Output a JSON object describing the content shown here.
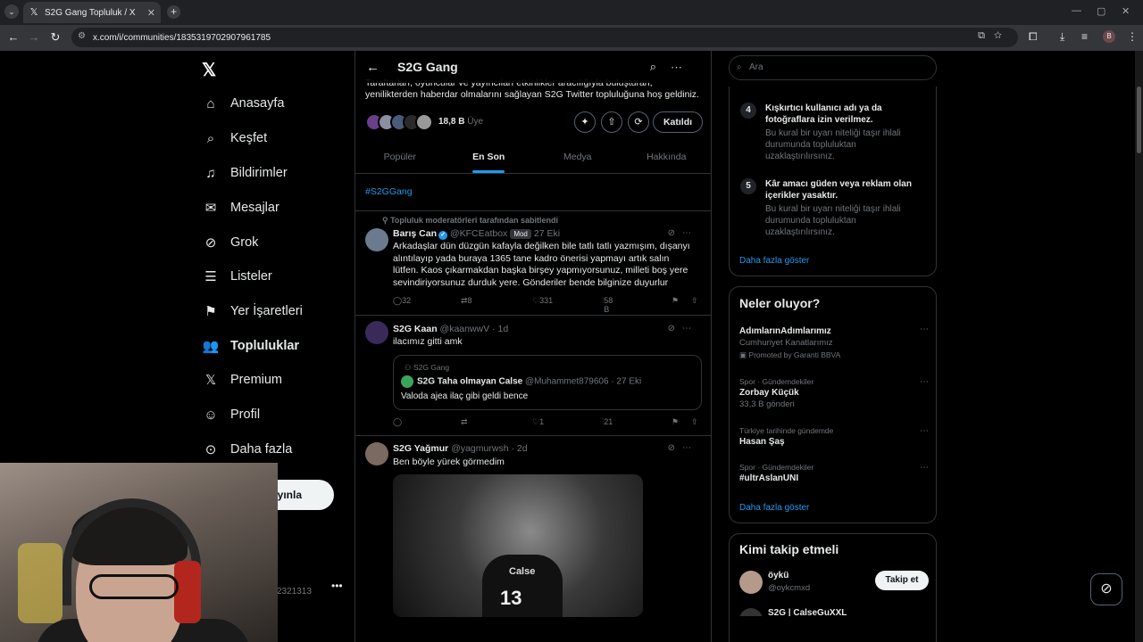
{
  "browser": {
    "tab_title": "S2G Gang Topluluk / X",
    "url": "x.com/i/communities/1835319702907961785",
    "profile_initial": "B"
  },
  "nav": {
    "items": [
      {
        "label": "Anasayfa",
        "icon": "home-icon"
      },
      {
        "label": "Keşfet",
        "icon": "search-icon"
      },
      {
        "label": "Bildirimler",
        "icon": "bell-icon"
      },
      {
        "label": "Mesajlar",
        "icon": "mail-icon"
      },
      {
        "label": "Grok",
        "icon": "grok-icon"
      },
      {
        "label": "Listeler",
        "icon": "list-icon"
      },
      {
        "label": "Yer İşaretleri",
        "icon": "bookmark-icon"
      },
      {
        "label": "Topluluklar",
        "icon": "communities-icon"
      },
      {
        "label": "Premium",
        "icon": "x-logo-icon"
      },
      {
        "label": "Profil",
        "icon": "profile-icon"
      },
      {
        "label": "Daha fazla",
        "icon": "more-icon"
      }
    ],
    "post_button": "ayınla",
    "account_handle": "2321313"
  },
  "community": {
    "name": "S2G Gang",
    "description_line1": "Taraftarları, oyuncular ve yayıncıları etkinlikler aracılığıyla buluşturan,",
    "description_line2": "yenilikterden haberdar olmalarını sağlayan S2G Twitter topluluğuna hoş geldiniz.",
    "member_count": "18,8 B",
    "member_label": "Üye",
    "join_label": "Katıldı",
    "tabs": [
      {
        "label": "Popüler",
        "active": false
      },
      {
        "label": "En Son",
        "active": true
      },
      {
        "label": "Medya",
        "active": false
      },
      {
        "label": "Hakkında",
        "active": false
      }
    ],
    "hashtag": "#S2GGang"
  },
  "posts": [
    {
      "pinned_label": "Topluluk moderatörleri tarafından sabitlendi",
      "name": "Barış Can",
      "handle": "@KFCEatbox",
      "badge": "Mod",
      "time": "27 Eki",
      "text": "Arkadaşlar dün düzgün kafayla değilken bile tatlı tatlı yazmışım, dışanyı alıntılayıp yada buraya 1365 tane kadro önerisi yapmayı artık salın lütfen. Kaos çıkarmakdan başka birşey yapmıyorsunuz, milleti boş yere sevindiriyorsunuz durduk yere. Gönderiler bende bilginize duyurlur",
      "replies": "32",
      "reposts": "8",
      "likes": "331",
      "views": "58 B"
    },
    {
      "name": "S2G Kaan",
      "handle": "@kaanwwV",
      "time": "1d",
      "text": "ilacımız gitti amk",
      "quote": {
        "community": "S2G Gang",
        "name": "S2G Taha olmayan Calse",
        "handle": "@Muhammet879606",
        "time": "27 Eki",
        "text": "Valoda ajea ilaç gibi geldi bence"
      },
      "replies": "",
      "reposts": "",
      "likes": "1",
      "views": "21"
    },
    {
      "name": "S2G Yağmur",
      "handle": "@yagmurwsh",
      "time": "2d",
      "text": "Ben böyle yürek görmedim",
      "media_label": "Calse",
      "media_number": "13"
    }
  ],
  "sidebar": {
    "search_placeholder": "Ara",
    "rules": [
      {
        "num": "4",
        "title": "Kışkırtıcı kullanıcı adı ya da fotoğraflara izin verilmez.",
        "desc": "Bu kural bir uyarı niteliği taşır ihlali durumunda topluluktan uzaklaştırılırsınız."
      },
      {
        "num": "5",
        "title": "Kâr amacı güden veya reklam olan içerikler yasaktır.",
        "desc": "Bu kural bir uyarı niteliği taşır ihlali durumunda topluluktan uzaklaştırılırsınız."
      }
    ],
    "show_more": "Daha fazla göster",
    "trends_title": "Neler oluyor?",
    "trends": [
      {
        "category": "",
        "title": "AdımlarınAdımlarımız",
        "sub": "Cumhuriyet Kanatlarımız",
        "promo": "Promoted by Garanti BBVA"
      },
      {
        "category": "Spor · Gündemdekiler",
        "title": "Zorbay Küçük",
        "sub": "33,3 B gönderi",
        "promo": ""
      },
      {
        "category": "Türkiye tarihinde gündemde",
        "title": "Hasan Şaş",
        "sub": "",
        "promo": ""
      },
      {
        "category": "Spor · Gündemdekiler",
        "title": "#ultrAslanUNI",
        "sub": "",
        "promo": ""
      }
    ],
    "trends_more": "Daha fazla göster",
    "follow_title": "Kimi takip etmeli",
    "follow": [
      {
        "name": "öykü",
        "handle": "@oykcmxd",
        "button": "Takip et"
      },
      {
        "name": "S2G | CalseGuXXL",
        "handle": "",
        "button": ""
      }
    ]
  }
}
